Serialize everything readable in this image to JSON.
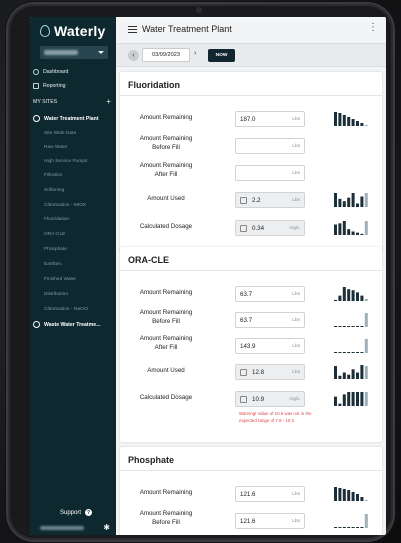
{
  "app": {
    "name": "Waterly"
  },
  "sidebar": {
    "nav": [
      {
        "label": "Dashboard"
      },
      {
        "label": "Reporting"
      }
    ],
    "my_sites_label": "MY SITES",
    "sites": [
      {
        "label": "Water Treatment Plant",
        "children": [
          {
            "label": "Site Wide Data"
          },
          {
            "label": "Raw Water"
          },
          {
            "label": "High Service Pumps"
          },
          {
            "label": "Filtration"
          },
          {
            "label": "Softening"
          },
          {
            "label": "Chlorination - MIOX"
          },
          {
            "label": "Fluoridation"
          },
          {
            "label": "ORA-CLE"
          },
          {
            "label": "Phosphate"
          },
          {
            "label": "Earthtec"
          },
          {
            "label": "Finished Water"
          },
          {
            "label": "Distribution"
          },
          {
            "label": "Chlorination - NaOCl"
          }
        ]
      },
      {
        "label": "Waste Water Treatme..."
      }
    ],
    "support_label": "Support"
  },
  "topbar": {
    "title": "Water Treatment Plant"
  },
  "datebar": {
    "date": "03/09/2023",
    "now_label": "NOW"
  },
  "cards": [
    {
      "title": "Fluoridation",
      "rows": [
        {
          "label_lines": [
            "Amount Remaining"
          ],
          "value": "187.0",
          "unit": "Lbs",
          "calc": false,
          "spark": [
            14,
            13,
            11,
            9,
            7,
            5,
            3,
            1
          ]
        },
        {
          "label_lines": [
            "Amount Remaining",
            "Before Fill"
          ],
          "value": "",
          "unit": "Lbs",
          "calc": false,
          "spark": []
        },
        {
          "label_lines": [
            "Amount Remaining",
            "After Fill"
          ],
          "value": "",
          "unit": "Lbs",
          "calc": false,
          "spark": []
        },
        {
          "label_lines": [
            "Amount Used"
          ],
          "value": "2.2",
          "unit": "Lbs",
          "calc": true,
          "spark": [
            12,
            7,
            5,
            8,
            12,
            3,
            9,
            12
          ]
        },
        {
          "label_lines": [
            "Calculated Dosage"
          ],
          "value": "0.34",
          "unit": "mg/L",
          "calc": true,
          "spark": [
            9,
            10,
            12,
            5,
            3,
            2,
            1,
            12
          ]
        }
      ]
    },
    {
      "title": "ORA-CLE",
      "rows": [
        {
          "label_lines": [
            "Amount Remaining"
          ],
          "value": "63.7",
          "unit": "Lbs",
          "calc": false,
          "spark": [
            1,
            5,
            13,
            11,
            10,
            8,
            5,
            2
          ]
        },
        {
          "label_lines": [
            "Amount Remaining",
            "Before Fill"
          ],
          "value": "63.7",
          "unit": "Lbs",
          "calc": false,
          "spark": [
            1,
            0,
            0,
            0,
            0,
            0,
            0,
            14
          ]
        },
        {
          "label_lines": [
            "Amount Remaining",
            "After Fill"
          ],
          "value": "143.9",
          "unit": "Lbs",
          "calc": false,
          "spark": [
            1,
            0,
            0,
            0,
            0,
            0,
            0,
            14
          ]
        },
        {
          "label_lines": [
            "Amount Used"
          ],
          "value": "12.8",
          "unit": "Lbs",
          "calc": true,
          "spark": [
            12,
            3,
            6,
            4,
            9,
            6,
            13,
            12
          ]
        },
        {
          "label_lines": [
            "Calculated Dosage"
          ],
          "value": "10.9",
          "unit": "mg/L",
          "calc": true,
          "spark": [
            8,
            2,
            10,
            12,
            12,
            12,
            12,
            12
          ],
          "warning": "Warning! Value of 10.9 was not in the expected range of 7.9 - 10.3"
        }
      ]
    },
    {
      "title": "Phosphate",
      "rows": [
        {
          "label_lines": [
            "Amount Remaining"
          ],
          "value": "121.6",
          "unit": "Lbs",
          "calc": false,
          "spark": [
            14,
            13,
            12,
            11,
            9,
            7,
            4,
            1
          ]
        },
        {
          "label_lines": [
            "Amount Remaining",
            "Before Fill"
          ],
          "value": "121.6",
          "unit": "Lbs",
          "calc": false,
          "spark": [
            1,
            0,
            0,
            0,
            0,
            0,
            0,
            14
          ]
        },
        {
          "label_lines": [
            "Amount Remaining",
            "After Fill"
          ],
          "value": "",
          "unit": "Lbs",
          "calc": false,
          "spark": []
        }
      ]
    }
  ],
  "colors": {
    "sidebar_bg": "#0e2830",
    "accent": "#11272f",
    "warning": "#e04545",
    "spark_dark": "#1c2e38",
    "spark_light": "#9fb0b8"
  }
}
